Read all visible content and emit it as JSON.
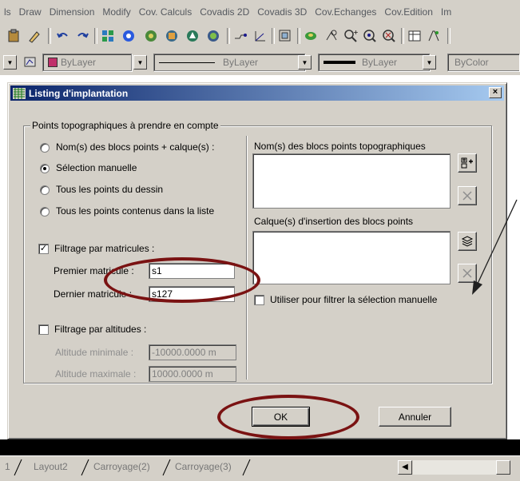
{
  "menu": [
    "ls",
    "Draw",
    "Dimension",
    "Modify",
    "Cov. Calculs",
    "Covadis 2D",
    "Covadis 3D",
    "Cov.Echanges",
    "Cov.Edition",
    "Im"
  ],
  "layerbar": {
    "layer_combo": "ByLayer",
    "linetype_combo": "ByLayer",
    "lineweight_combo": "ByLayer",
    "color_combo": "ByColor",
    "layer_color": "#c0306a"
  },
  "dialog": {
    "title": "Listing d'implantation",
    "close_glyph": "×",
    "group_title": "Points topographiques à prendre en compte",
    "radios": [
      {
        "label": "Nom(s) des blocs points + calque(s) :",
        "selected": false
      },
      {
        "label": "Sélection manuelle",
        "selected": true
      },
      {
        "label": "Tous les points du dessin",
        "selected": false
      },
      {
        "label": "Tous les points contenus dans la liste",
        "selected": false
      }
    ],
    "filter_matricules": {
      "label": "Filtrage par matricules :",
      "checked": true,
      "premier_label": "Premier matricule :",
      "premier_value": "s1",
      "dernier_label": "Dernier matricule :",
      "dernier_value": "s127"
    },
    "filter_altitudes": {
      "label": "Filtrage par altitudes :",
      "checked": false,
      "min_label": "Altitude minimale :",
      "min_value": "-10000.0000 m",
      "max_label": "Altitude maximale :",
      "max_value": "10000.0000 m"
    },
    "blocks_list_label": "Nom(s) des blocs points topographiques",
    "layers_list_label": "Calque(s) d'insertion des blocs points",
    "use_filter_label": "Utiliser pour filtrer la sélection manuelle",
    "use_filter_checked": false,
    "ok_label": "OK",
    "cancel_label": "Annuler"
  },
  "tabs": [
    "1",
    "Layout2",
    "Carroyage(2)",
    "Carroyage(3)"
  ],
  "annotation_color": "#7a1212"
}
